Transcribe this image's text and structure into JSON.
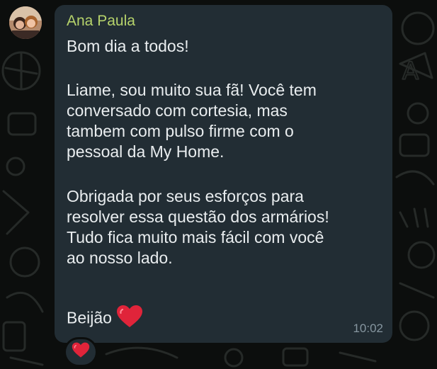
{
  "message": {
    "sender": "Ana Paula",
    "lines": [
      "Bom dia a todos!",
      "Liame, sou muito sua fã! Você tem",
      "conversado com cortesia, mas",
      "tambem com pulso firme com o",
      "pessoal da My Home.",
      "Obrigada por seus esforços para",
      "resolver essa questão dos armários!",
      "Tudo fica muito mais fácil com você",
      "ao nosso lado.",
      "Beijão"
    ],
    "time": "10:02",
    "reaction_icon": "red-heart-icon"
  },
  "colors": {
    "sender": "#b6d36b",
    "bubble": "#222d34",
    "text": "#e9edef",
    "timestamp": "#8696a0",
    "heart": "#e0243a"
  }
}
